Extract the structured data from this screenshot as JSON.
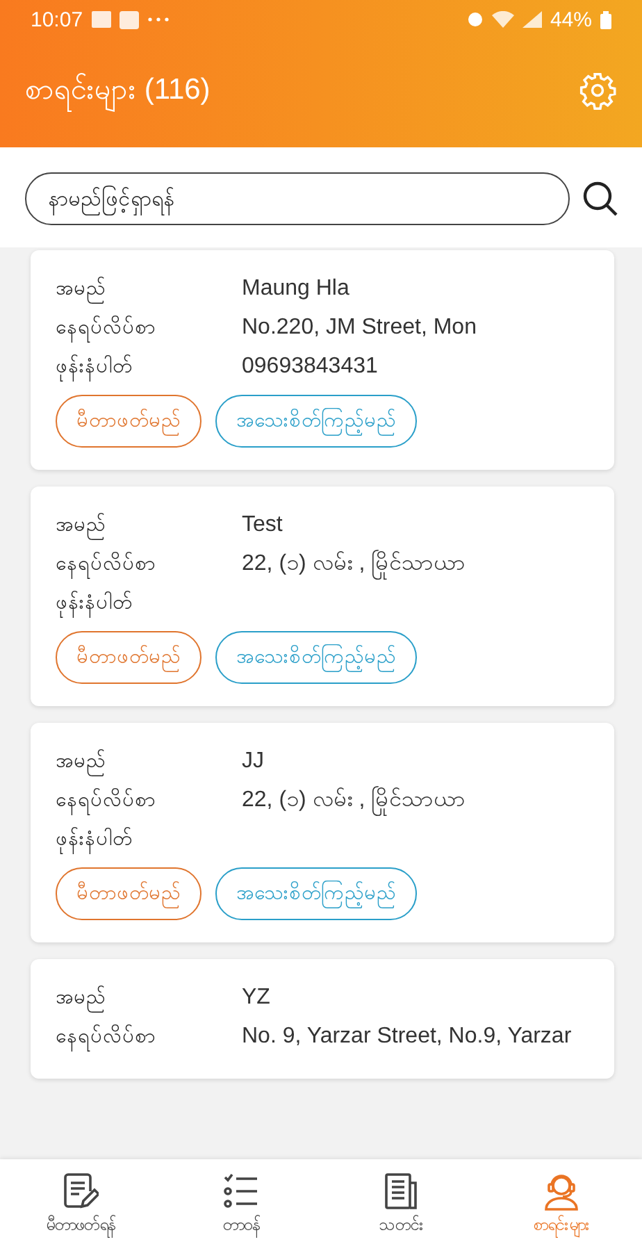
{
  "status_bar": {
    "time": "10:07",
    "battery": "44%"
  },
  "header": {
    "title": "စာရင်းများ (116)"
  },
  "search": {
    "placeholder": "နာမည်ဖြင့်ရှာရန်"
  },
  "cards": [
    {
      "rows": [
        {
          "label": "အမည်",
          "value": "Maung Hla"
        },
        {
          "label": "နေရပ်လိပ်စာ",
          "value": "No.220, JM Street, Mon"
        },
        {
          "label": "ဖုန်းနံပါတ်",
          "value": "09693843431"
        }
      ],
      "buttons": [
        {
          "label": "မီတာဖတ်မည်",
          "kind": "read"
        },
        {
          "label": "အသေးစိတ်ကြည့်မည်",
          "kind": "detail"
        }
      ]
    },
    {
      "rows": [
        {
          "label": "အမည်",
          "value": "Test"
        },
        {
          "label": "နေရပ်လိပ်စာ",
          "value": "22, (၁) လမ်း , မြိုင်သာယာ"
        },
        {
          "label": "ဖုန်းနံပါတ်"
        }
      ],
      "buttons": [
        {
          "label": "မီတာဖတ်မည်",
          "kind": "read"
        },
        {
          "label": "အသေးစိတ်ကြည့်မည်",
          "kind": "detail"
        }
      ]
    },
    {
      "rows": [
        {
          "label": "အမည်",
          "value": "JJ"
        },
        {
          "label": "နေရပ်လိပ်စာ",
          "value": "22, (၁) လမ်း , မြိုင်သာယာ"
        },
        {
          "label": "ဖုန်းနံပါတ်"
        }
      ],
      "buttons": [
        {
          "label": "မီတာဖတ်မည်",
          "kind": "read"
        },
        {
          "label": "အသေးစိတ်ကြည့်မည်",
          "kind": "detail"
        }
      ]
    },
    {
      "rows": [
        {
          "label": "အမည်",
          "value": "YZ"
        },
        {
          "label": "နေရပ်လိပ်စာ",
          "value": "No. 9, Yarzar Street, No.9, Yarzar"
        }
      ]
    }
  ],
  "bottom_nav": [
    {
      "label": "မီတာဖတ်ရန်",
      "kind": "note",
      "selected": false
    },
    {
      "label": "တာဝန်",
      "kind": "checklist",
      "selected": false
    },
    {
      "label": "သတင်း",
      "kind": "news",
      "selected": false
    },
    {
      "label": "စာရင်းများ",
      "kind": "agent",
      "selected": true
    }
  ]
}
